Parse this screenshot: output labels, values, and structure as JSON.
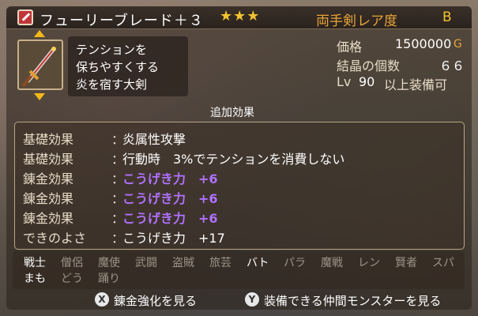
{
  "header": {
    "item_name": "フューリーブレード＋３",
    "stars": "★★★",
    "category": "両手剣",
    "rarity_label": "レア度",
    "rarity_value": "B"
  },
  "description": [
    "テンションを",
    "保ちやすくする",
    "炎を宿す大剣"
  ],
  "stats": {
    "price_label": "価格",
    "price_value": "1500000",
    "price_unit": "G",
    "crystal_label": "結晶の個数",
    "crystal_value": "６６",
    "level_prefix": "Lv",
    "level_value": "90",
    "level_suffix": "以上装備可"
  },
  "effects": {
    "title": "追加効果",
    "rows": [
      {
        "label": "基礎効果",
        "colon": "：",
        "value": "炎属性攻撃",
        "style": "normal"
      },
      {
        "label": "基礎効果",
        "colon": "：",
        "value": "行動時　3%でテンションを消費しない",
        "style": "normal"
      },
      {
        "label": "錬金効果",
        "colon": "：",
        "value": "こうげき力　+6",
        "style": "purple"
      },
      {
        "label": "錬金効果",
        "colon": "：",
        "value": "こうげき力　+6",
        "style": "purple"
      },
      {
        "label": "錬金効果",
        "colon": "：",
        "value": "こうげき力　+6",
        "style": "purple"
      },
      {
        "label": "できのよさ",
        "colon": "：",
        "value": "こうげき力　+17",
        "style": "normal"
      }
    ]
  },
  "jobs": {
    "row1": [
      {
        "name": "戦士",
        "enabled": true
      },
      {
        "name": "僧侶",
        "enabled": false
      },
      {
        "name": "魔使",
        "enabled": false
      },
      {
        "name": "武闘",
        "enabled": false
      },
      {
        "name": "盗賊",
        "enabled": false
      },
      {
        "name": "旅芸",
        "enabled": false
      },
      {
        "name": "バト",
        "enabled": true
      },
      {
        "name": "パラ",
        "enabled": false
      },
      {
        "name": "魔戦",
        "enabled": false
      },
      {
        "name": "レン",
        "enabled": false
      },
      {
        "name": "賢者",
        "enabled": false
      },
      {
        "name": "スパ",
        "enabled": false
      }
    ],
    "row2": [
      {
        "name": "まも",
        "enabled": true
      },
      {
        "name": "どう",
        "enabled": false
      },
      {
        "name": "踊り",
        "enabled": false
      }
    ]
  },
  "buttons": {
    "x_key": "X",
    "x_label": "錬金強化を見る",
    "y_key": "Y",
    "y_label": "装備できる仲間モンスターを見る"
  }
}
